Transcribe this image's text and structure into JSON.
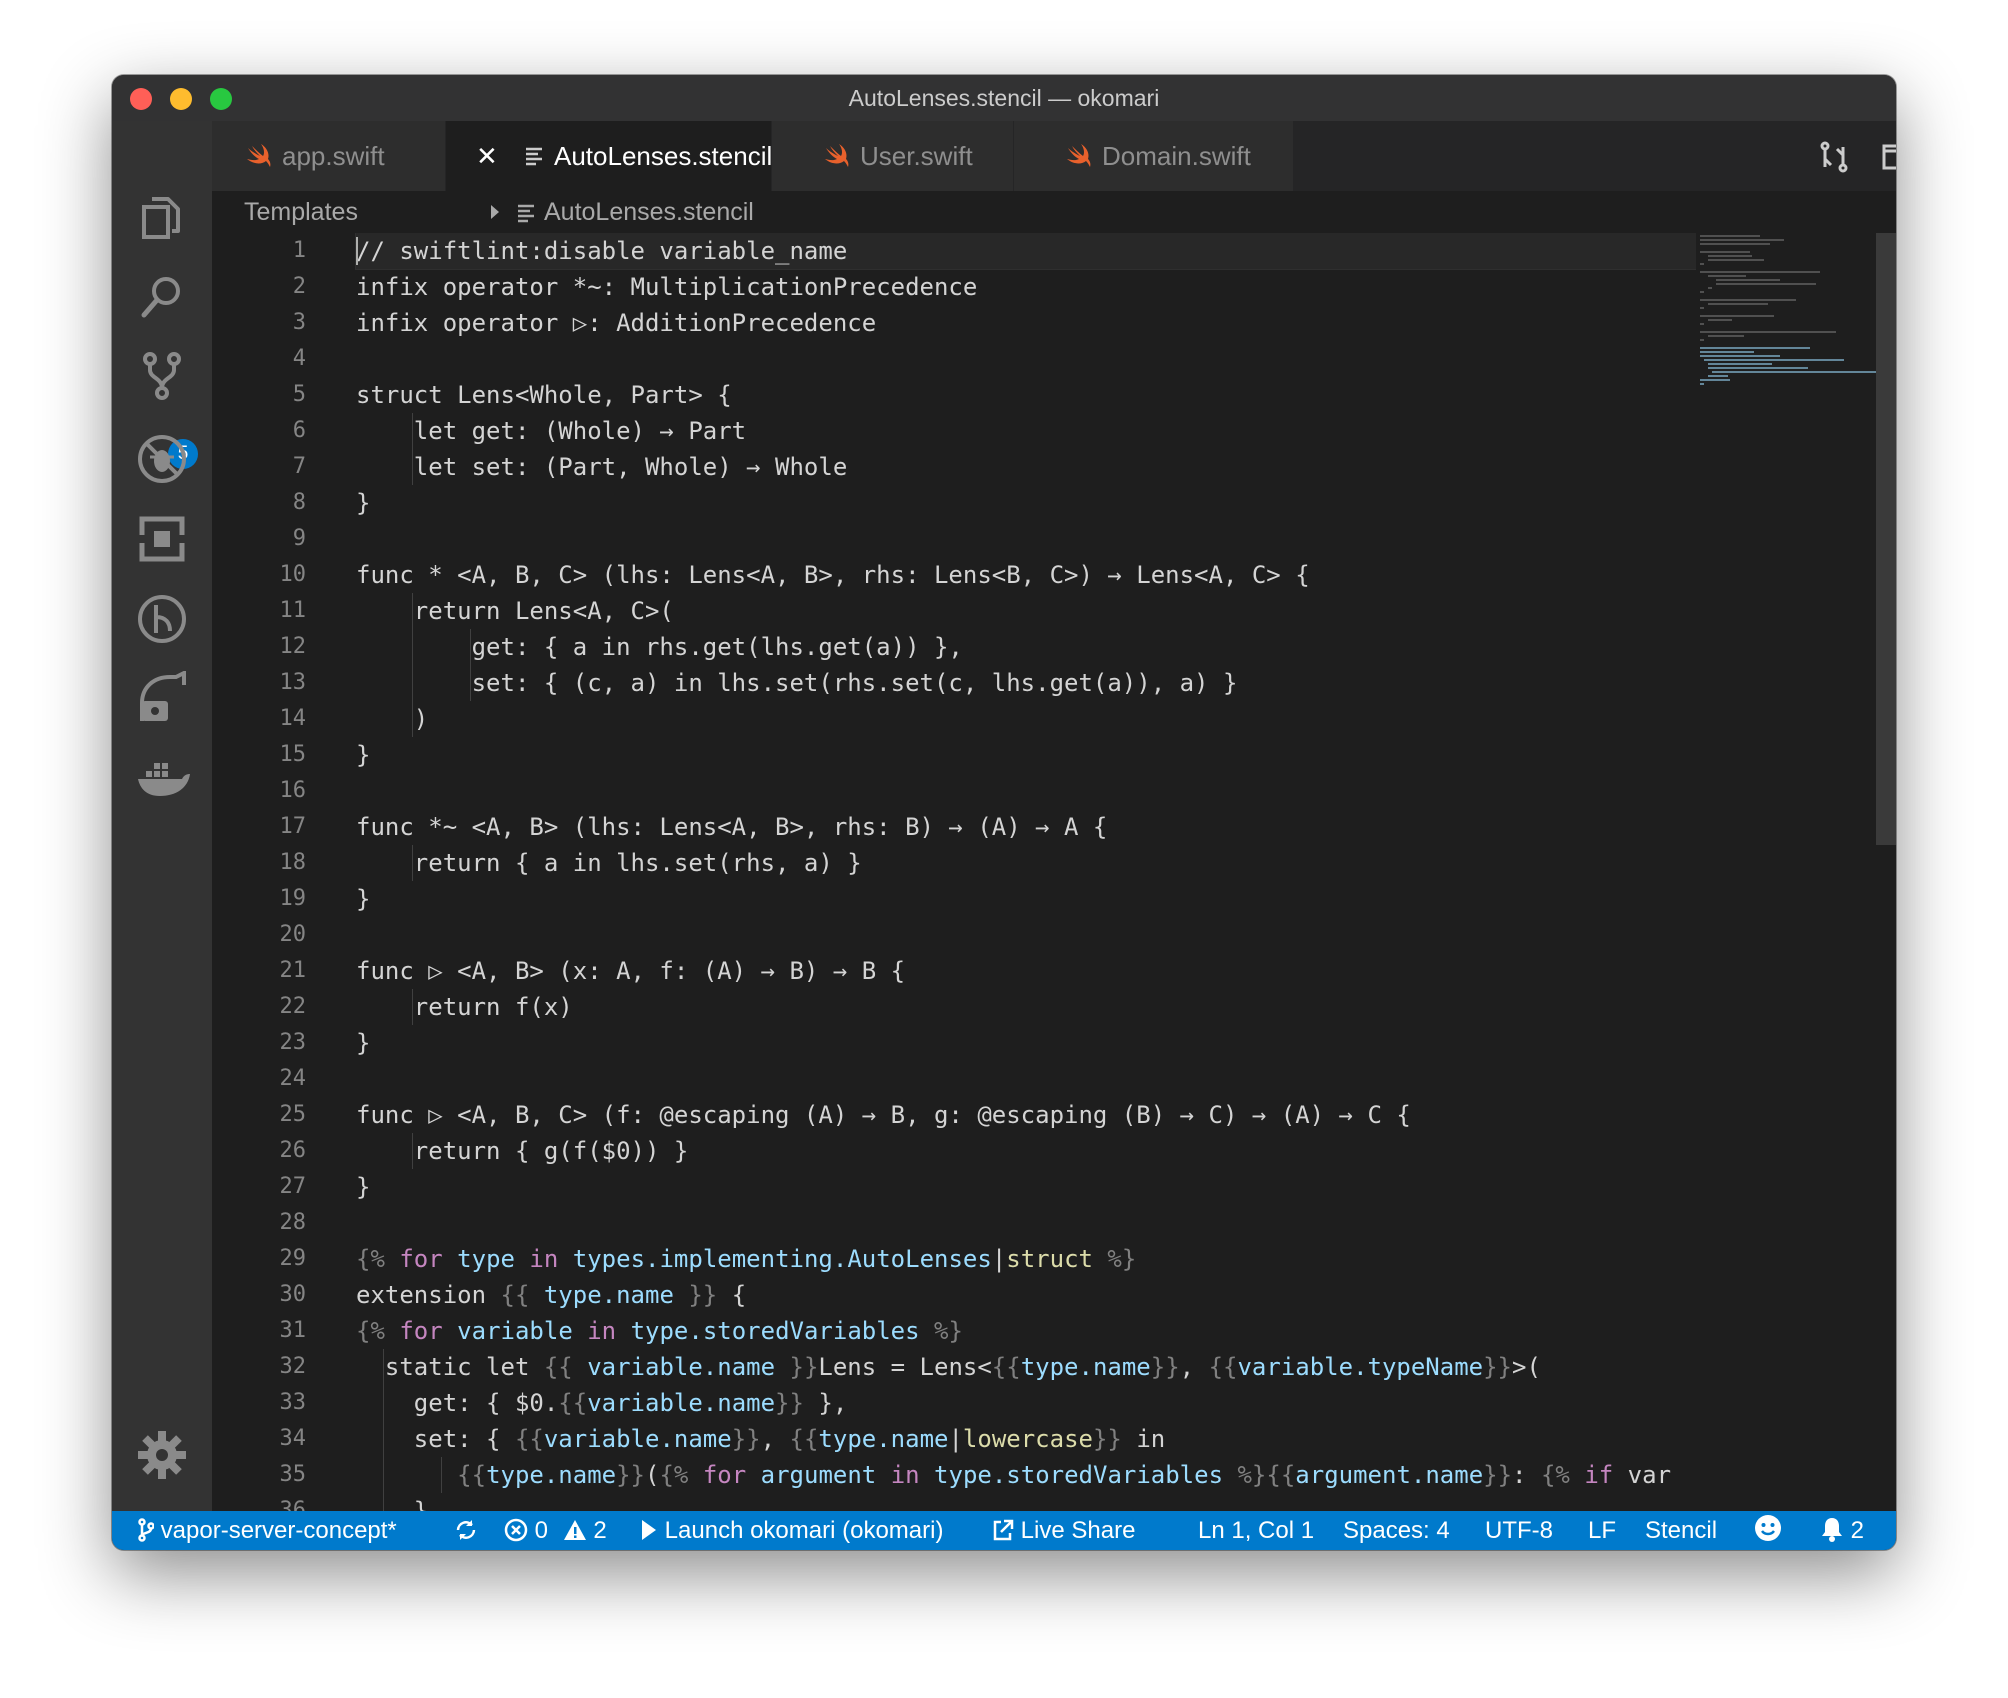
{
  "window": {
    "title": "AutoLenses.stencil — okomari"
  },
  "colors": {
    "accent": "#007acc",
    "swift_icon": "#e8612c",
    "editor_bg": "#1e1e1e",
    "keyword": "#c586c0",
    "variable": "#9cdcfe",
    "function": "#dcdcaa"
  },
  "activity_bar": {
    "items": [
      {
        "icon": "explorer-icon"
      },
      {
        "icon": "search-icon"
      },
      {
        "icon": "source-control-icon",
        "badge": "5"
      },
      {
        "icon": "debug-icon"
      },
      {
        "icon": "extensions-icon"
      },
      {
        "icon": "timeline-icon"
      },
      {
        "icon": "remote-explorer-icon"
      },
      {
        "icon": "docker-icon"
      }
    ],
    "settings_icon": "gear-icon"
  },
  "tabs": [
    {
      "label": "app.swift",
      "icon": "swift-icon",
      "active": false
    },
    {
      "label": "AutoLenses.stencil",
      "icon": "file-lines-icon",
      "active": true,
      "close": "✕"
    },
    {
      "label": "User.swift",
      "icon": "swift-icon",
      "active": false
    },
    {
      "label": "Domain.swift",
      "icon": "swift-icon",
      "active": false
    }
  ],
  "editor_actions": [
    "open-changes-icon",
    "split-editor-icon",
    "more-icon"
  ],
  "breadcrumb": {
    "folder": "Templates",
    "file": "AutoLenses.stencil"
  },
  "code": {
    "line_numbers": [
      "1",
      "2",
      "3",
      "4",
      "5",
      "6",
      "7",
      "8",
      "9",
      "10",
      "11",
      "12",
      "13",
      "14",
      "15",
      "16",
      "17",
      "18",
      "19",
      "20",
      "21",
      "22",
      "23",
      "24",
      "25",
      "26",
      "27",
      "28",
      "29",
      "30",
      "31",
      "32",
      "33",
      "34",
      "35",
      "36"
    ],
    "lines": [
      "// swiftlint:disable variable_name",
      "infix operator *~: MultiplicationPrecedence",
      "infix operator ▷: AdditionPrecedence",
      "",
      "struct Lens<Whole, Part> {",
      "    let get: (Whole) → Part",
      "    let set: (Part, Whole) → Whole",
      "}",
      "",
      "func * <A, B, C> (lhs: Lens<A, B>, rhs: Lens<B, C>) → Lens<A, C> {",
      "    return Lens<A, C>(",
      "        get: { a in rhs.get(lhs.get(a)) },",
      "        set: { (c, a) in lhs.set(rhs.set(c, lhs.get(a)), a) }",
      "    )",
      "}",
      "",
      "func *~ <A, B> (lhs: Lens<A, B>, rhs: B) → (A) → A {",
      "    return { a in lhs.set(rhs, a) }",
      "}",
      "",
      "func ▷ <A, B> (x: A, f: (A) → B) → B {",
      "    return f(x)",
      "}",
      "",
      "func ▷ <A, B, C> (f: @escaping (A) → B, g: @escaping (B) → C) → (A) → C {",
      "    return { g(f($0)) }",
      "}",
      "",
      "{% for type in types.implementing.AutoLenses|struct %}",
      "extension {{ type.name }} {",
      "{% for variable in type.storedVariables %}",
      "  static let {{ variable.name }}Lens = Lens<{{type.name}}, {{variable.typeName}}>(",
      "    get: { $0.{{variable.name}} },",
      "    set: { {{variable.name}}, {{type.name|lowercase}} in",
      "       {{type.name}}({% for argument in type.storedVariables %}{{argument.name}}: {% if varia",
      "    }"
    ]
  },
  "status_bar": {
    "branch": "vapor-server-concept*",
    "errors": "0",
    "warnings": "2",
    "launch": "Launch okomari (okomari)",
    "live_share": "Live Share",
    "position": "Ln 1, Col 1",
    "spaces": "Spaces: 4",
    "encoding": "UTF-8",
    "eol": "LF",
    "language": "Stencil",
    "notifications": "2"
  }
}
